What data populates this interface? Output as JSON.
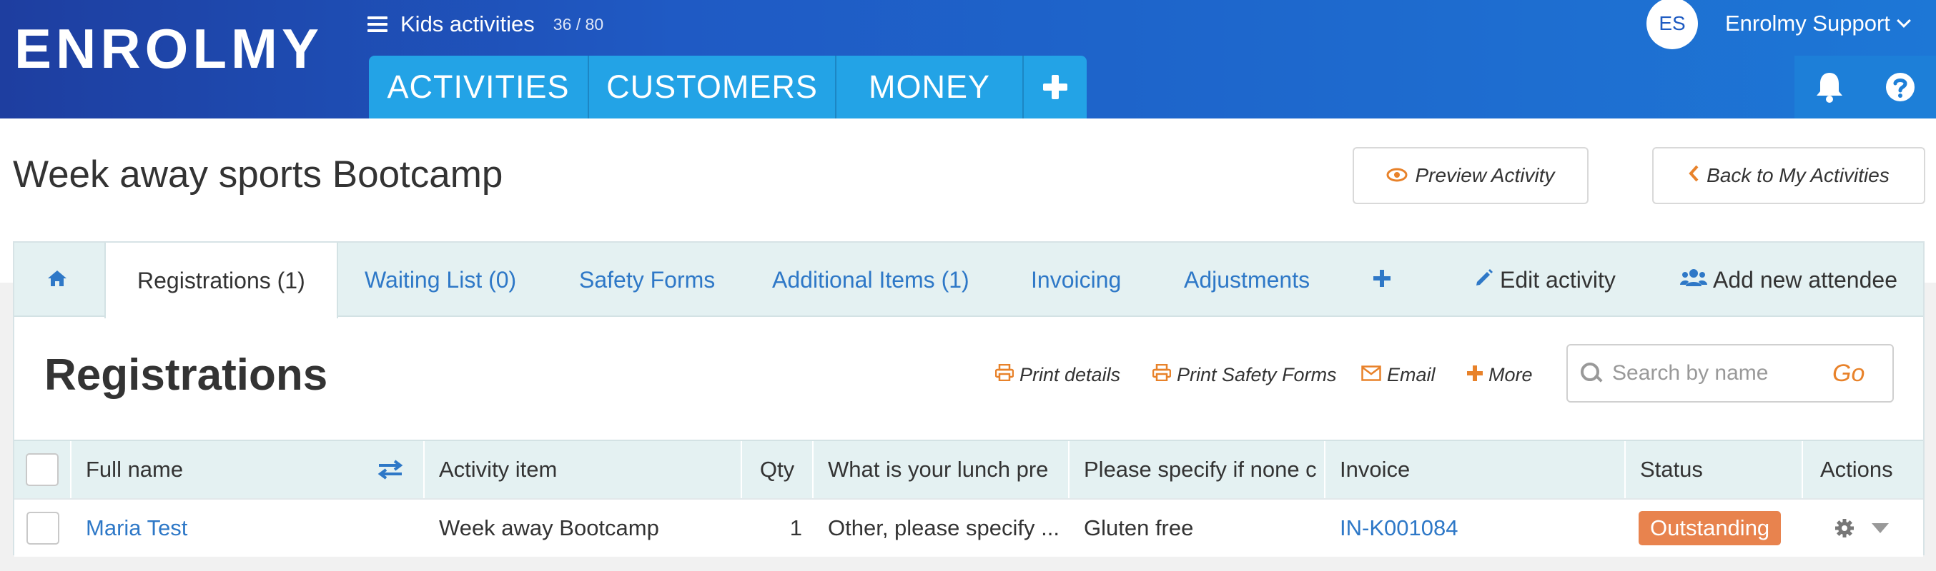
{
  "brand": {
    "logo_text": "ENROLMY"
  },
  "context": {
    "title": "Kids activities",
    "count": "36 / 80"
  },
  "main_nav": {
    "activities": "ACTIVITIES",
    "customers": "CUSTOMERS",
    "money": "MONEY"
  },
  "user": {
    "initials": "ES",
    "name": "Enrolmy Support"
  },
  "page": {
    "title": "Week away sports Bootcamp",
    "preview_button": "Preview Activity",
    "back_button": "Back to My Activities"
  },
  "subtabs": {
    "registrations": "Registrations (1)",
    "waiting_list": "Waiting List (0)",
    "safety_forms": "Safety Forms",
    "additional_items": "Additional Items (1)",
    "invoicing": "Invoicing",
    "adjustments": "Adjustments",
    "edit_activity": "Edit activity",
    "add_attendee": "Add new attendee"
  },
  "section": {
    "title": "Registrations",
    "print_details": "Print details",
    "print_safety_forms": "Print Safety Forms",
    "email": "Email",
    "more": "More",
    "search_placeholder": "Search by name",
    "search_go": "Go"
  },
  "table": {
    "headers": {
      "full_name": "Full name",
      "activity_item": "Activity item",
      "qty": "Qty",
      "lunch": "What is your lunch pre",
      "specify": "Please specify if none c",
      "invoice": "Invoice",
      "status": "Status",
      "actions": "Actions"
    },
    "rows": [
      {
        "full_name": "Maria Test",
        "activity_item": "Week away Bootcamp",
        "qty": "1",
        "lunch": "Other, please specify ...",
        "specify": "Gluten free",
        "invoice": "IN-K001084",
        "status": "Outstanding"
      }
    ]
  },
  "colors": {
    "topbar_start": "#1e3ea0",
    "topbar_end": "#1d77d6",
    "nav_tab": "#23a3e6",
    "link_blue": "#2e78c7",
    "accent_orange": "#e8822a",
    "status_outstanding": "#e8834e",
    "subtab_bg": "#e4f1f2"
  },
  "icons": {
    "menu": "hamburger-icon",
    "add": "plus-icon",
    "notifications": "bell-icon",
    "help": "question-icon",
    "home": "home-icon",
    "preview": "eye-icon",
    "back": "chevron-left-icon",
    "edit": "pencil-icon",
    "attendee": "users-icon",
    "print": "printer-icon",
    "email": "envelope-icon",
    "search": "search-icon",
    "sort": "swap-icon",
    "settings": "gear-icon",
    "dropdown": "caret-down-icon"
  }
}
